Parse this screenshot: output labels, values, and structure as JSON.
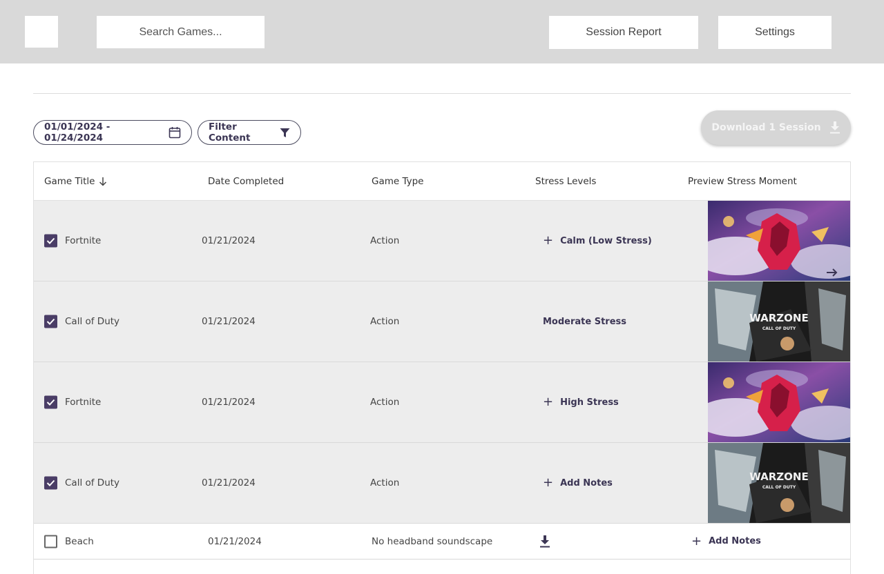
{
  "topbar": {
    "search_placeholder": "Search Games...",
    "session_report_label": "Session Report",
    "settings_label": "Settings"
  },
  "toolbar": {
    "date_range": "01/01/2024 - 01/24/2024",
    "filter_label": "Filter Content",
    "download_label": "Download 1 Session"
  },
  "table": {
    "headers": [
      "Game Title",
      "Date Completed",
      "Game Type",
      "Stress Levels",
      "Preview Stress Moment"
    ],
    "rows": [
      {
        "checked": true,
        "title": "Fortnite",
        "date": "01/21/2024",
        "type": "Action",
        "stress": "Calm (Low Stress)",
        "stress_plus": true,
        "preview": "fortnite"
      },
      {
        "checked": true,
        "title": "Call of Duty",
        "date": "01/21/2024",
        "type": "Action",
        "stress": "Moderate Stress",
        "stress_plus": false,
        "preview": "warzone"
      },
      {
        "checked": true,
        "title": "Fortnite",
        "date": "01/21/2024",
        "type": "Action",
        "stress": "High Stress",
        "stress_plus": true,
        "preview": "fortnite"
      },
      {
        "checked": true,
        "title": "Call of Duty",
        "date": "01/21/2024",
        "type": "Action",
        "stress": "Add Notes",
        "stress_plus": true,
        "preview": "warzone"
      },
      {
        "checked": false,
        "title": "Beach",
        "date": "01/21/2024",
        "type": "No headband soundscape",
        "stress": "",
        "notes": "Add Notes"
      }
    ],
    "warzone_logo": "WARZONE",
    "warzone_sub": "CALL OF DUTY"
  },
  "colors": {
    "accent": "#3b3554",
    "checkbox": "#4a3d66",
    "topbar": "#d9d9d9",
    "selected_row": "#ededed"
  }
}
